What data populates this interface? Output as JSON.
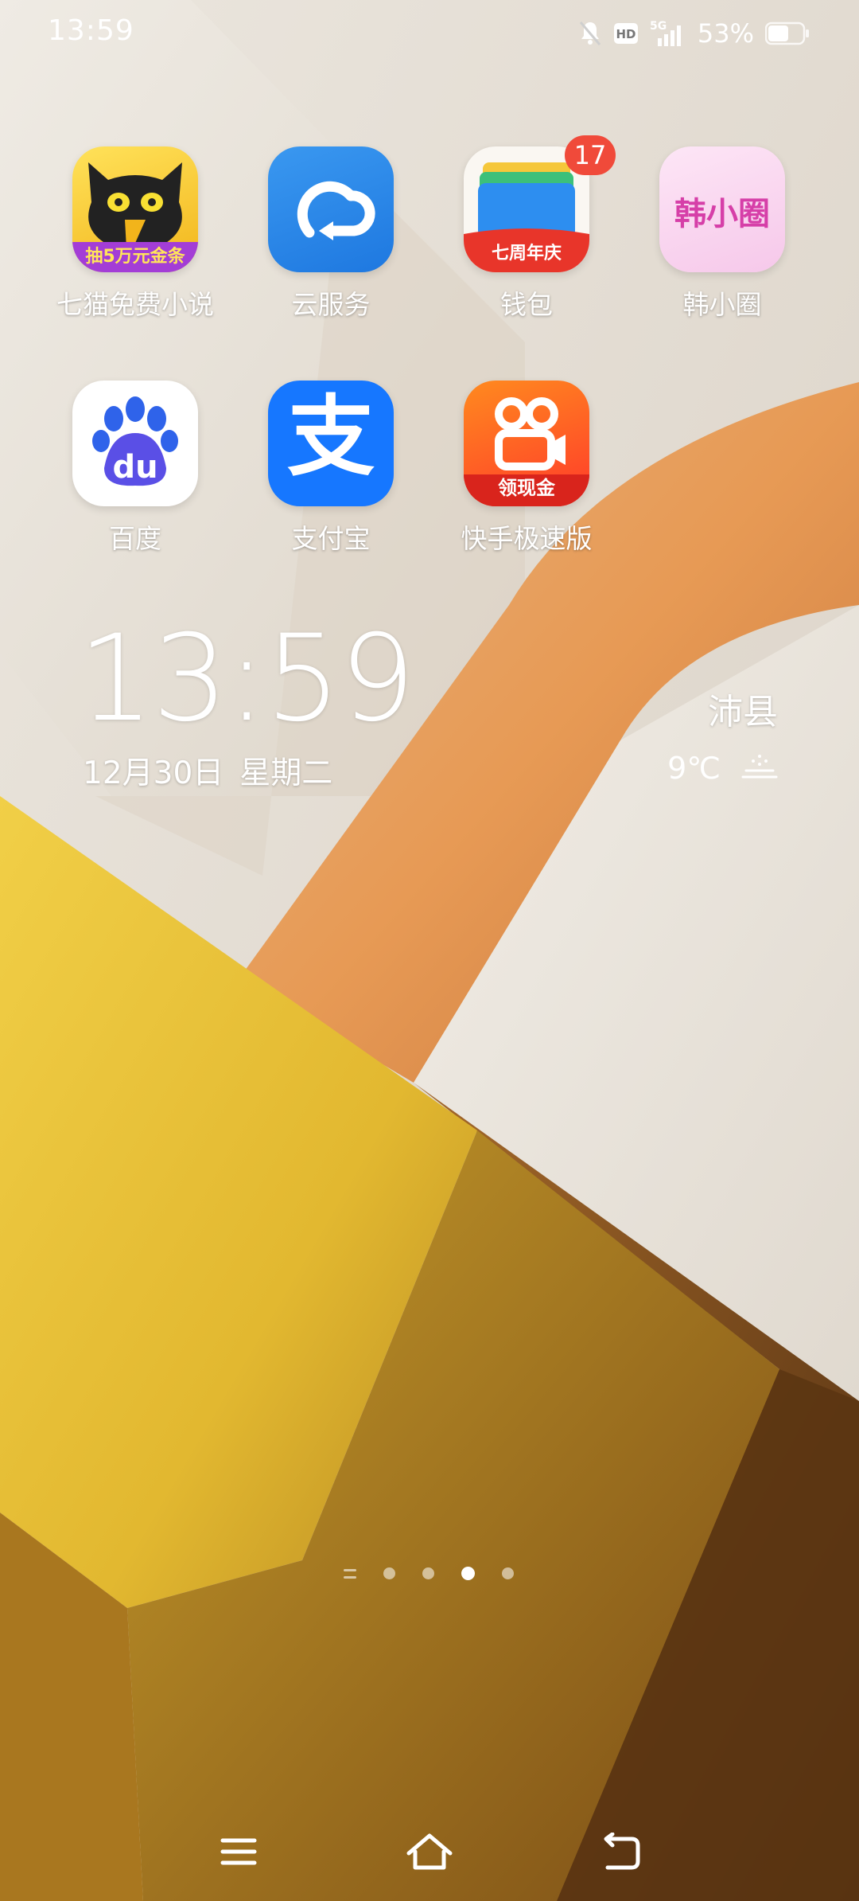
{
  "status_bar": {
    "time": "13:59",
    "network": "5G",
    "hd_label": "HD",
    "battery_percent": "53%",
    "icons": [
      "mute-bell-icon",
      "hd-icon",
      "5g-signal-icon",
      "battery-icon"
    ]
  },
  "apps": [
    {
      "label": "七猫免费小说",
      "icon": "qimao-cat-icon",
      "icon_text": "抽5万元金条",
      "accent": "#f5c518"
    },
    {
      "label": "云服务",
      "icon": "cloud-sync-icon",
      "accent": "#2b86e8"
    },
    {
      "label": "钱包",
      "icon": "wallet-icon",
      "icon_text": "七周年庆",
      "badge": "17",
      "accent": "#e8352a"
    },
    {
      "label": "韩小圈",
      "icon": "hanxiaoquan-logo-icon",
      "icon_text": "韩小圈",
      "accent": "#d63fa8"
    },
    {
      "label": "百度",
      "icon": "baidu-paw-icon",
      "icon_text": "du",
      "accent": "#3062e6"
    },
    {
      "label": "支付宝",
      "icon": "alipay-icon",
      "icon_text": "支",
      "accent": "#1677ff"
    },
    {
      "label": "快手极速版",
      "icon": "kuaishou-lite-icon",
      "icon_text": "领现金",
      "accent": "#ff5a1f"
    }
  ],
  "clock_widget": {
    "time": "13:59",
    "date": "12月30日",
    "weekday": "星期二"
  },
  "weather_widget": {
    "city": "沛县",
    "temperature": "9℃",
    "condition_icon": "haze-icon"
  },
  "page_indicator": {
    "pages": 5,
    "active_index": 3
  },
  "nav_bar": {
    "buttons": [
      "menu-icon",
      "home-icon",
      "back-icon"
    ]
  }
}
